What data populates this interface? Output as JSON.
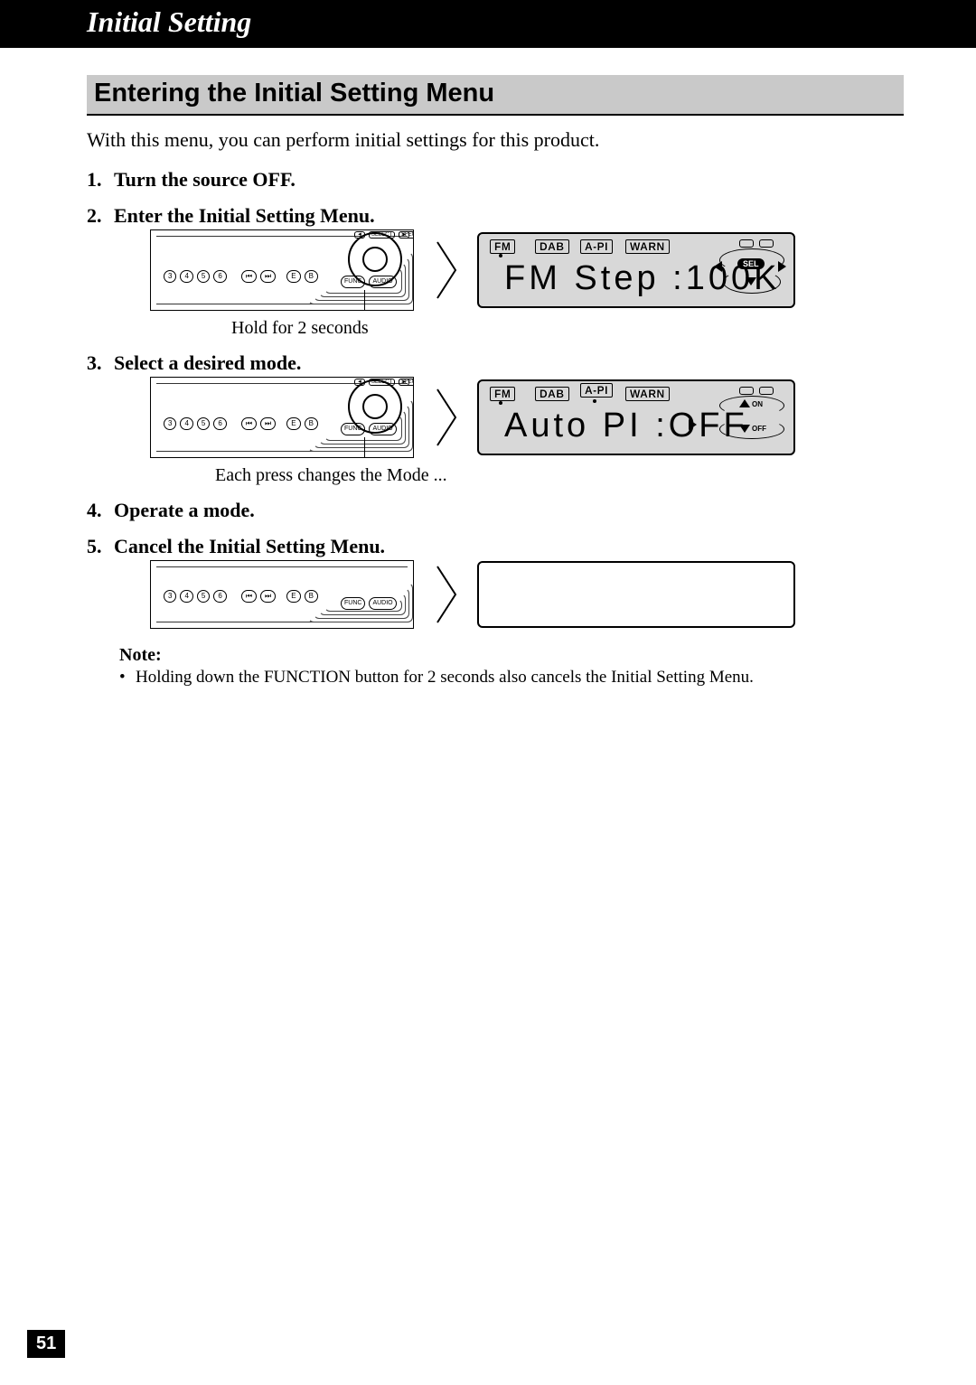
{
  "header": {
    "title": "Initial Setting"
  },
  "section": {
    "heading": "Entering the Initial Setting Menu",
    "intro": "With this menu, you can perform initial settings for this product."
  },
  "steps": [
    {
      "text": "Turn the source OFF."
    },
    {
      "text": "Enter the Initial Setting Menu."
    },
    {
      "text": "Select a desired mode."
    },
    {
      "text": "Operate a mode."
    },
    {
      "text": "Cancel the Initial Setting Menu."
    }
  ],
  "captions": {
    "hold": "Hold for 2 seconds",
    "each_press": "Each press changes the Mode ..."
  },
  "panel": {
    "buttons": [
      "3",
      "4",
      "5",
      "6"
    ],
    "skip_icons": [
      "⏮",
      "⏭"
    ],
    "labels": {
      "e": "E",
      "b": "B",
      "func": "FUNC",
      "audio": "AUDIO",
      "select": "SELECT",
      "sfeq": "SFEQ"
    }
  },
  "display1": {
    "tags": {
      "fm": "FM",
      "dab": "DAB",
      "api": "A-PI",
      "warn": "WARN"
    },
    "main": "FM Step  :100K",
    "sel": "SEL"
  },
  "display2": {
    "tags": {
      "fm": "FM",
      "dab": "DAB",
      "api": "A-PI",
      "warn": "WARN"
    },
    "main": "Auto PI  :OFF",
    "on": "ON",
    "off": "OFF"
  },
  "note": {
    "title": "Note:",
    "item": "Holding down the FUNCTION button for 2 seconds also cancels the Initial Setting Menu."
  },
  "page_number": "51"
}
